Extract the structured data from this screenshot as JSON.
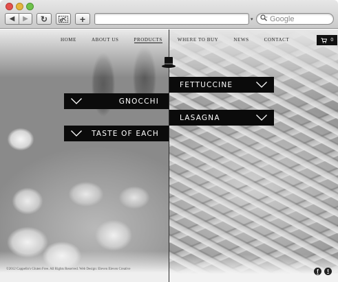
{
  "browser": {
    "nav_back": "◀",
    "nav_forward": "▶",
    "reload_icon": "↻",
    "add_tab": "+",
    "url_value": "",
    "search_placeholder": "Google",
    "rss_glyph": "▾"
  },
  "nav": {
    "items": [
      {
        "label": "HOME",
        "active": false
      },
      {
        "label": "ABOUT US",
        "active": false
      },
      {
        "label": "PRODUCTS",
        "active": true
      },
      {
        "label": "WHERE TO BUY",
        "active": false
      },
      {
        "label": "NEWS",
        "active": false
      },
      {
        "label": "CONTACT",
        "active": false
      }
    ]
  },
  "cart": {
    "count": "0"
  },
  "menus": {
    "fettuccine": "FETTUCCINE",
    "gnocchi": "GNOCCHI",
    "lasagna": "LASAGNA",
    "taste": "TASTE OF EACH"
  },
  "footer": {
    "text": "©2012 Cappello's Gluten Free. All Rights Reserved. Web Design: Eleven Eleven Creative"
  },
  "social": {
    "facebook": "f",
    "twitter": "t"
  },
  "colors": {
    "bar": "#0b0b0b",
    "bar_text": "#ffffff"
  }
}
